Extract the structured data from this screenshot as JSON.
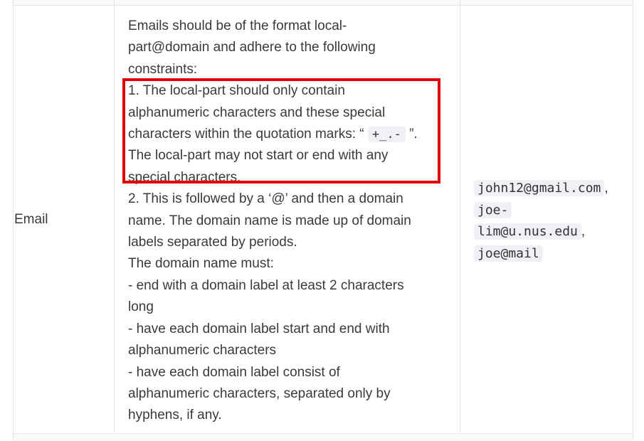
{
  "row": {
    "field": "Email",
    "constraints_lines": [
      "Emails should be of the format local-",
      "part@domain and adhere to the following",
      "constraints:",
      "1. The local-part should only contain",
      "alphanumeric characters and these special",
      "characters within the quotation marks: “",
      "”.",
      "The local-part may not start or end with any",
      "special characters.",
      "2. This is followed by a ‘@’ and then a domain",
      "name. The domain name is made up of domain",
      "labels separated by periods.",
      "The domain name must:",
      "- end with a domain label at least 2 characters",
      "long",
      "- have each domain label start and end with",
      "alphanumeric characters",
      "- have each domain label consist of",
      "alphanumeric characters, separated only by",
      "hyphens, if any."
    ],
    "special_chars_code": "+_.-",
    "examples": {
      "ex1": "john12@gmail.com",
      "sep1": ",",
      "ex2_part1": "joe-",
      "ex2_part2": "lim@u.nus.edu",
      "sep2": ",",
      "ex3": "joe@mail"
    }
  },
  "colors": {
    "highlight": "#e10000",
    "code_bg": "#f1f0f7",
    "border": "#e6e6e6"
  }
}
